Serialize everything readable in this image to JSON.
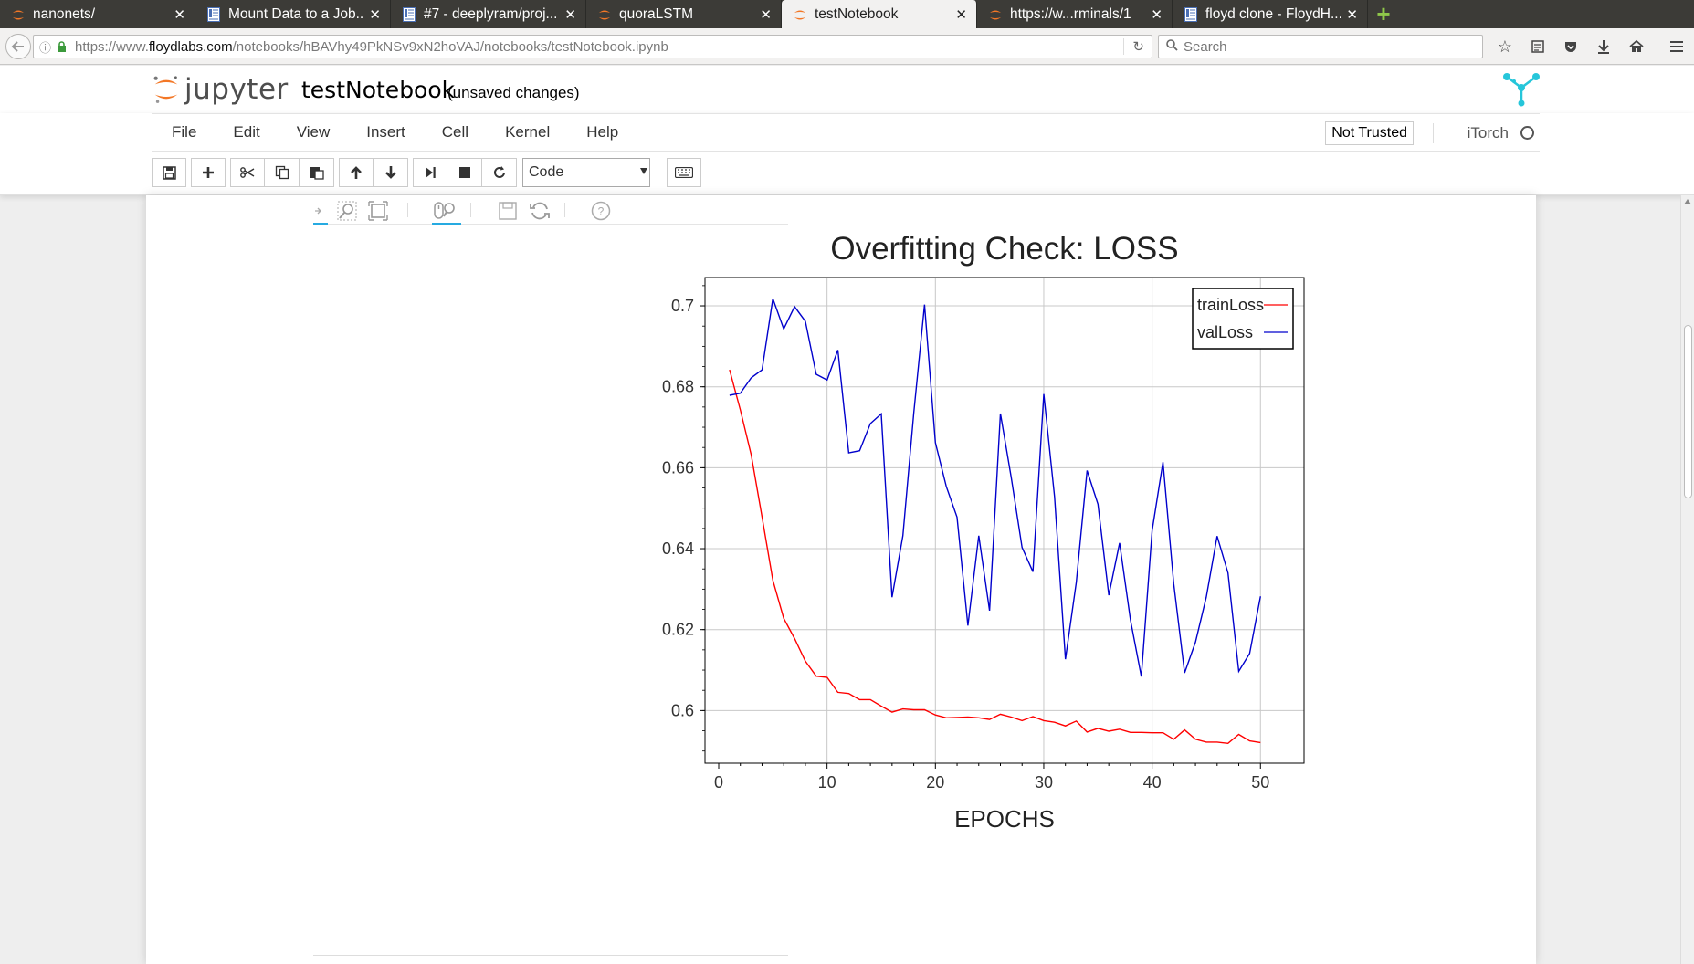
{
  "browser": {
    "tabs": [
      {
        "title": "nanonets/",
        "icon": "jupyter-icon"
      },
      {
        "title": "Mount Data to a Job...",
        "icon": "floyd-doc-icon"
      },
      {
        "title": "#7 - deeplyram/proj...",
        "icon": "floyd-doc-icon"
      },
      {
        "title": "quoraLSTM",
        "icon": "jupyter-icon"
      },
      {
        "title": "testNotebook",
        "icon": "jupyter-icon",
        "active": true
      },
      {
        "title": "https://w...rminals/1",
        "icon": "jupyter-icon"
      },
      {
        "title": "floyd clone - FloydH...",
        "icon": "floyd-doc-icon"
      }
    ],
    "url_prefix": "https://www.",
    "url_domain": "floydlabs.com",
    "url_path": "/notebooks/hBAVhy49PkNSv9xN2hoVAJ/notebooks/testNotebook.ipynb",
    "search_placeholder": "Search"
  },
  "jupyter": {
    "logo_text": "jupyter",
    "notebook_name": "testNotebook",
    "save_status": "(unsaved changes)",
    "menu": [
      "File",
      "Edit",
      "View",
      "Insert",
      "Cell",
      "Kernel",
      "Help"
    ],
    "trust_label": "Not Trusted",
    "kernel_name": "iTorch",
    "cell_type": "Code"
  },
  "colors": {
    "train": "#ff0000",
    "val": "#0000cc",
    "accent": "#f37726",
    "floyd": "#26c6da"
  },
  "chart_data": {
    "type": "line",
    "title": "Overfitting Check: LOSS",
    "xlabel": "EPOCHS",
    "ylabel": "",
    "xlim": [
      0,
      52
    ],
    "ylim": [
      0.587,
      0.707
    ],
    "xticks": [
      0,
      10,
      20,
      30,
      40,
      50
    ],
    "yticks": [
      0.6,
      0.62,
      0.64,
      0.66,
      0.68,
      0.7
    ],
    "ytick_labels": [
      "0.6",
      "0.62",
      "0.64",
      "0.66",
      "0.68",
      "0.7"
    ],
    "grid": true,
    "legend": "top-right",
    "x": [
      1,
      2,
      3,
      4,
      5,
      6,
      7,
      8,
      9,
      10,
      11,
      12,
      13,
      14,
      15,
      16,
      17,
      18,
      19,
      20,
      21,
      22,
      23,
      24,
      25,
      26,
      27,
      28,
      29,
      30,
      31,
      32,
      33,
      34,
      35,
      36,
      37,
      38,
      39,
      40,
      41,
      42,
      43,
      44,
      45,
      46,
      47,
      48,
      49,
      50
    ],
    "series": [
      {
        "name": "trainLoss",
        "color": "#ff0000",
        "values": [
          0.6842,
          0.6743,
          0.6632,
          0.6478,
          0.6322,
          0.6228,
          0.6178,
          0.6122,
          0.6085,
          0.6082,
          0.6045,
          0.6042,
          0.6027,
          0.6027,
          0.6011,
          0.5996,
          0.6004,
          0.6002,
          0.6002,
          0.5989,
          0.5982,
          0.5983,
          0.5984,
          0.5982,
          0.5978,
          0.5991,
          0.5984,
          0.5975,
          0.5985,
          0.5975,
          0.5971,
          0.5962,
          0.5974,
          0.5947,
          0.5956,
          0.5949,
          0.5954,
          0.5946,
          0.5946,
          0.5945,
          0.5945,
          0.5929,
          0.5952,
          0.5929,
          0.5922,
          0.5922,
          0.5919,
          0.5941,
          0.5925,
          0.5921
        ]
      },
      {
        "name": "valLoss",
        "color": "#0000cc",
        "values": [
          0.6779,
          0.6784,
          0.6822,
          0.6842,
          0.7018,
          0.6943,
          0.6998,
          0.6962,
          0.6831,
          0.6817,
          0.6891,
          0.6637,
          0.6642,
          0.6709,
          0.6733,
          0.628,
          0.6432,
          0.6735,
          0.7003,
          0.6662,
          0.6554,
          0.6478,
          0.621,
          0.6432,
          0.6247,
          0.6734,
          0.6575,
          0.6403,
          0.6343,
          0.6782,
          0.6528,
          0.6127,
          0.6317,
          0.6593,
          0.651,
          0.6285,
          0.6414,
          0.6224,
          0.6084,
          0.6444,
          0.6614,
          0.6313,
          0.6093,
          0.6169,
          0.628,
          0.6431,
          0.634,
          0.6097,
          0.6141,
          0.6282
        ]
      }
    ]
  }
}
